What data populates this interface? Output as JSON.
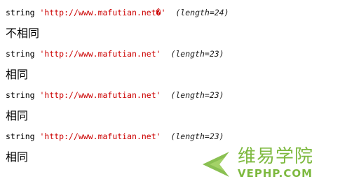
{
  "dumps": [
    {
      "type": "string",
      "value": "'http://www.mafutian.net",
      "trailing": "�'",
      "length": "(length=24)",
      "result": "不相同"
    },
    {
      "type": "string",
      "value": "'http://www.mafutian.net'",
      "trailing": "",
      "length": "(length=23)",
      "result": "相同"
    },
    {
      "type": "string",
      "value": "'http://www.mafutian.net'",
      "trailing": "",
      "length": "(length=23)",
      "result": "相同"
    },
    {
      "type": "string",
      "value": "'http://www.mafutian.net'",
      "trailing": "",
      "length": "(length=23)",
      "result": "相同"
    }
  ],
  "watermark": {
    "chinese": "维易学院",
    "english": "VEPHP.COM",
    "color": "#7db93f"
  },
  "colors": {
    "string_value": "#cc0000",
    "text": "#000000"
  }
}
